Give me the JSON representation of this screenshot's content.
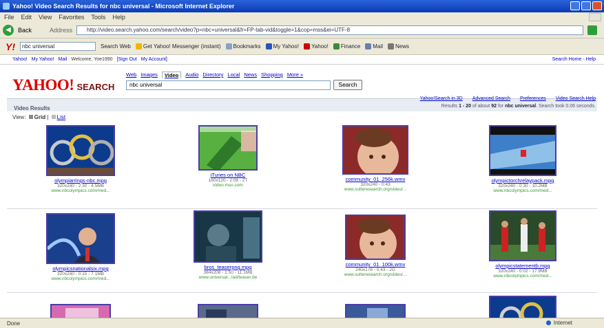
{
  "window": {
    "title": "Yahoo! Video Search Results for nbc universal - Microsoft Internet Explorer"
  },
  "menu": [
    "File",
    "Edit",
    "View",
    "Favorites",
    "Tools",
    "Help"
  ],
  "nav": {
    "back_label": "Back",
    "address_label": "Address",
    "address_url": "http://video.search.yahoo.com/search/video?p=nbc+universal&fr=FP-tab-vid&toggle=1&cop=mss&ei=UTF-8"
  },
  "toolbar": {
    "search_text": "nbc universal",
    "search_web_label": "Search Web",
    "messenger_label": "Get Yahoo! Messenger (instant)",
    "bookmarks_label": "Bookmarks",
    "my_yahoo_label": "My Yahoo!",
    "yahoo_label": "Yahoo!",
    "finance_label": "Finance",
    "mail_label": "Mail",
    "news_label": "News"
  },
  "ylinks": {
    "left": [
      "Yahoo!",
      "My Yahoo!",
      "Mail",
      "Welcome, Yoe1990",
      "[Sign Out",
      "My Account]"
    ],
    "right": "Search Home - Help"
  },
  "header": {
    "logo_text": "YAHOO!",
    "logo_sub": "SEARCH",
    "tabs": [
      "Web",
      "Images",
      "Video",
      "Audio",
      "Directory",
      "Local",
      "News",
      "Shopping",
      "More »"
    ],
    "active_tab": "Video",
    "query": "nbc universal",
    "search_button": "Search"
  },
  "results": {
    "label": "Video Results",
    "top_links": [
      "Yahoo!Search in 3D",
      "Advanced Search",
      "Preferences",
      "Video Search Help"
    ],
    "count_prefix": "Results",
    "range": "1 - 20",
    "count_mid": "of about",
    "total": "92",
    "count_for": "for",
    "query": "nbc universal",
    "time_text": ". Search took 0.06 seconds.",
    "view_label": "View:",
    "view_grid": "Grid",
    "view_list": "List"
  },
  "videos": [
    {
      "file": "olympiarrings-nbc.mpg",
      "meta": "320x240 - 2:30 - 4.5MB",
      "source": "www.nbcolympics.com/med..."
    },
    {
      "file": "iTunes on NBC",
      "meta": "160x120 - 2:08 - 2T",
      "source": "video.msn.com"
    },
    {
      "file": "community_01_256k.wmv",
      "meta": "320x240 - 0:43",
      "source": "www.sutteresearch.org/video/..."
    },
    {
      "file": "olympictorchrelaypack.mpg",
      "meta": "320x240 - 0:30 - 10.2MB",
      "source": "www.nbcolympics.com/med..."
    },
    {
      "file": "olympicsnationalsix.mpg",
      "meta": "320x240 - 0:15 - 7.1MB",
      "source": "www.nbcolympics.com/med..."
    },
    {
      "file": "bros_teaserpng.mpg",
      "meta": "384x208 - 1:50 - 11.1MB",
      "source": "www.universal.../ad/teaser.de"
    },
    {
      "file": "community_01_100k.wmv",
      "meta": "240x176 - 0:43 - 2G",
      "source": "www.sutteresearch.org/video/..."
    },
    {
      "file": "olympicstatementb.mpg",
      "meta": "320x240 - 0:02 - 17.9MB",
      "source": "www.nbcolympics.com/med..."
    }
  ],
  "status": {
    "left": "Done",
    "zone": "Internet"
  }
}
